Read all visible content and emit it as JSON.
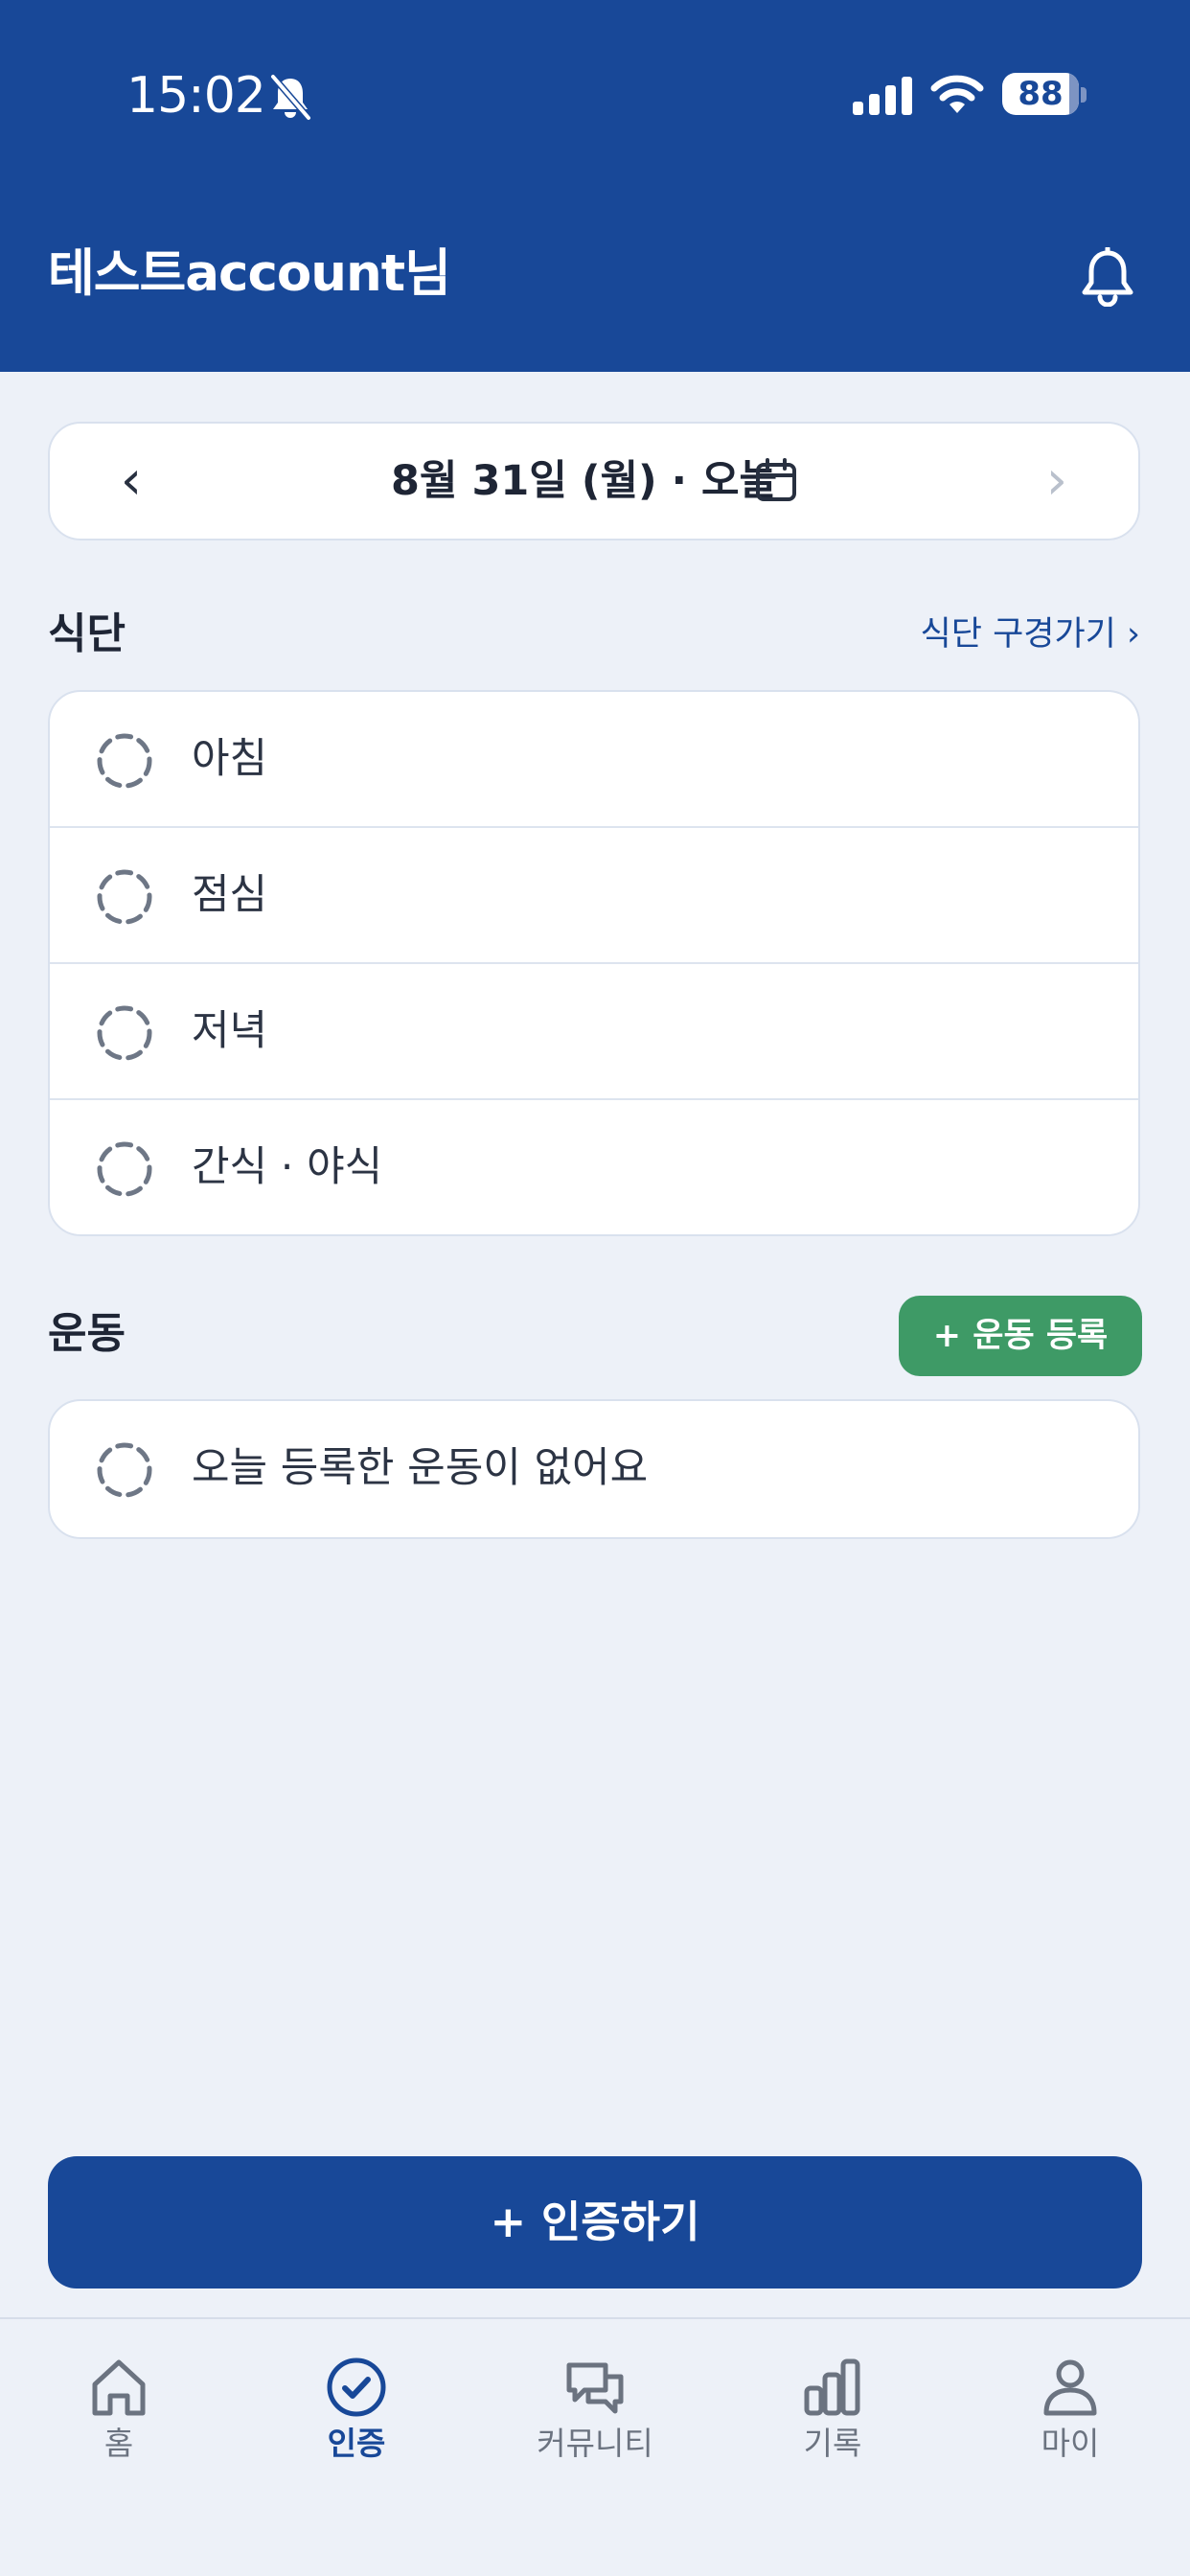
{
  "status_bar": {
    "time": "15:02",
    "battery_level": "88",
    "icons": [
      "bell-slash-icon",
      "signal-icon",
      "wifi-icon",
      "battery-icon"
    ]
  },
  "header": {
    "greeting": "테스트account님",
    "bell_icon": "bell-icon"
  },
  "date_nav": {
    "prev": "‹",
    "label": "8월 31일 (월) · 오늘",
    "next": "›",
    "calendar_icon": "calendar-icon"
  },
  "meals": {
    "title": "식단",
    "link": "식단 구경가기 ›",
    "items": [
      {
        "label": "아침"
      },
      {
        "label": "점심"
      },
      {
        "label": "저녁"
      },
      {
        "label": "간식 · 야식"
      }
    ]
  },
  "exercise": {
    "title": "운동",
    "add_button": "+ 운동 등록",
    "empty_text": "오늘 등록한 운동이 없어요"
  },
  "certify_button": "+ 인증하기",
  "tabs": [
    {
      "label": "홈",
      "icon": "home-icon",
      "active": false
    },
    {
      "label": "인증",
      "icon": "check-circle-icon",
      "active": true
    },
    {
      "label": "커뮤니티",
      "icon": "chat-bubbles-icon",
      "active": false
    },
    {
      "label": "기록",
      "icon": "bar-chart-icon",
      "active": false
    },
    {
      "label": "마이",
      "icon": "person-icon",
      "active": false
    }
  ],
  "colors": {
    "brand": "#184898",
    "background": "#EDF1F8",
    "exercise_green": "#3E9A66",
    "inactive_tab": "#6B7380"
  }
}
